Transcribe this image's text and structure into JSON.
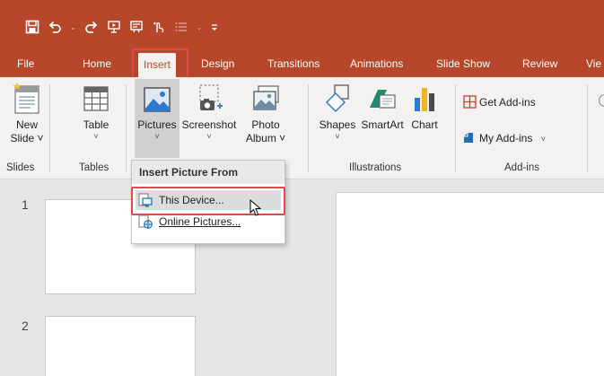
{
  "quick_access": {
    "icons": [
      "save-icon",
      "undo-icon",
      "redo-icon",
      "from-beginning-icon",
      "present-icon",
      "touch-mode-icon",
      "list-icon",
      "customize-icon"
    ]
  },
  "tabs": [
    {
      "label": "File"
    },
    {
      "label": "Home"
    },
    {
      "label": "Insert",
      "active": true
    },
    {
      "label": "Design"
    },
    {
      "label": "Transitions"
    },
    {
      "label": "Animations"
    },
    {
      "label": "Slide Show"
    },
    {
      "label": "Review"
    },
    {
      "label": "Vie"
    }
  ],
  "ribbon": {
    "new_slide": {
      "line1": "New",
      "line2": "Slide ˅"
    },
    "table": {
      "label": "Table",
      "chevron": "˅"
    },
    "pictures": {
      "label": "Pictures",
      "chevron": "˅"
    },
    "screenshot": {
      "label": "Screenshot",
      "chevron": "˅"
    },
    "photo_album": {
      "line1": "Photo",
      "line2": "Album ˅"
    },
    "shapes": {
      "label": "Shapes",
      "chevron": "˅"
    },
    "smartart": {
      "label": "SmartArt"
    },
    "chart": {
      "label": "Chart"
    },
    "get_addins": {
      "label": "Get Add-ins"
    },
    "my_addins": {
      "label": "My Add-ins",
      "chevron": "˅"
    },
    "groups": {
      "slides": "Slides",
      "tables": "Tables",
      "illustrations": "Illustrations",
      "addins": "Add-ins"
    }
  },
  "dropdown": {
    "header": "Insert Picture From",
    "items": [
      {
        "label": "This Device...",
        "accel": "D",
        "highlighted": true
      },
      {
        "label": "Online Pictures...",
        "accel": "O"
      }
    ]
  },
  "slides_pane": {
    "numbers": [
      "1",
      "2"
    ]
  },
  "colors": {
    "brand": "#b7472a",
    "highlight_box": "#e04a4a",
    "ribbon_bg": "#f3f2f1"
  }
}
